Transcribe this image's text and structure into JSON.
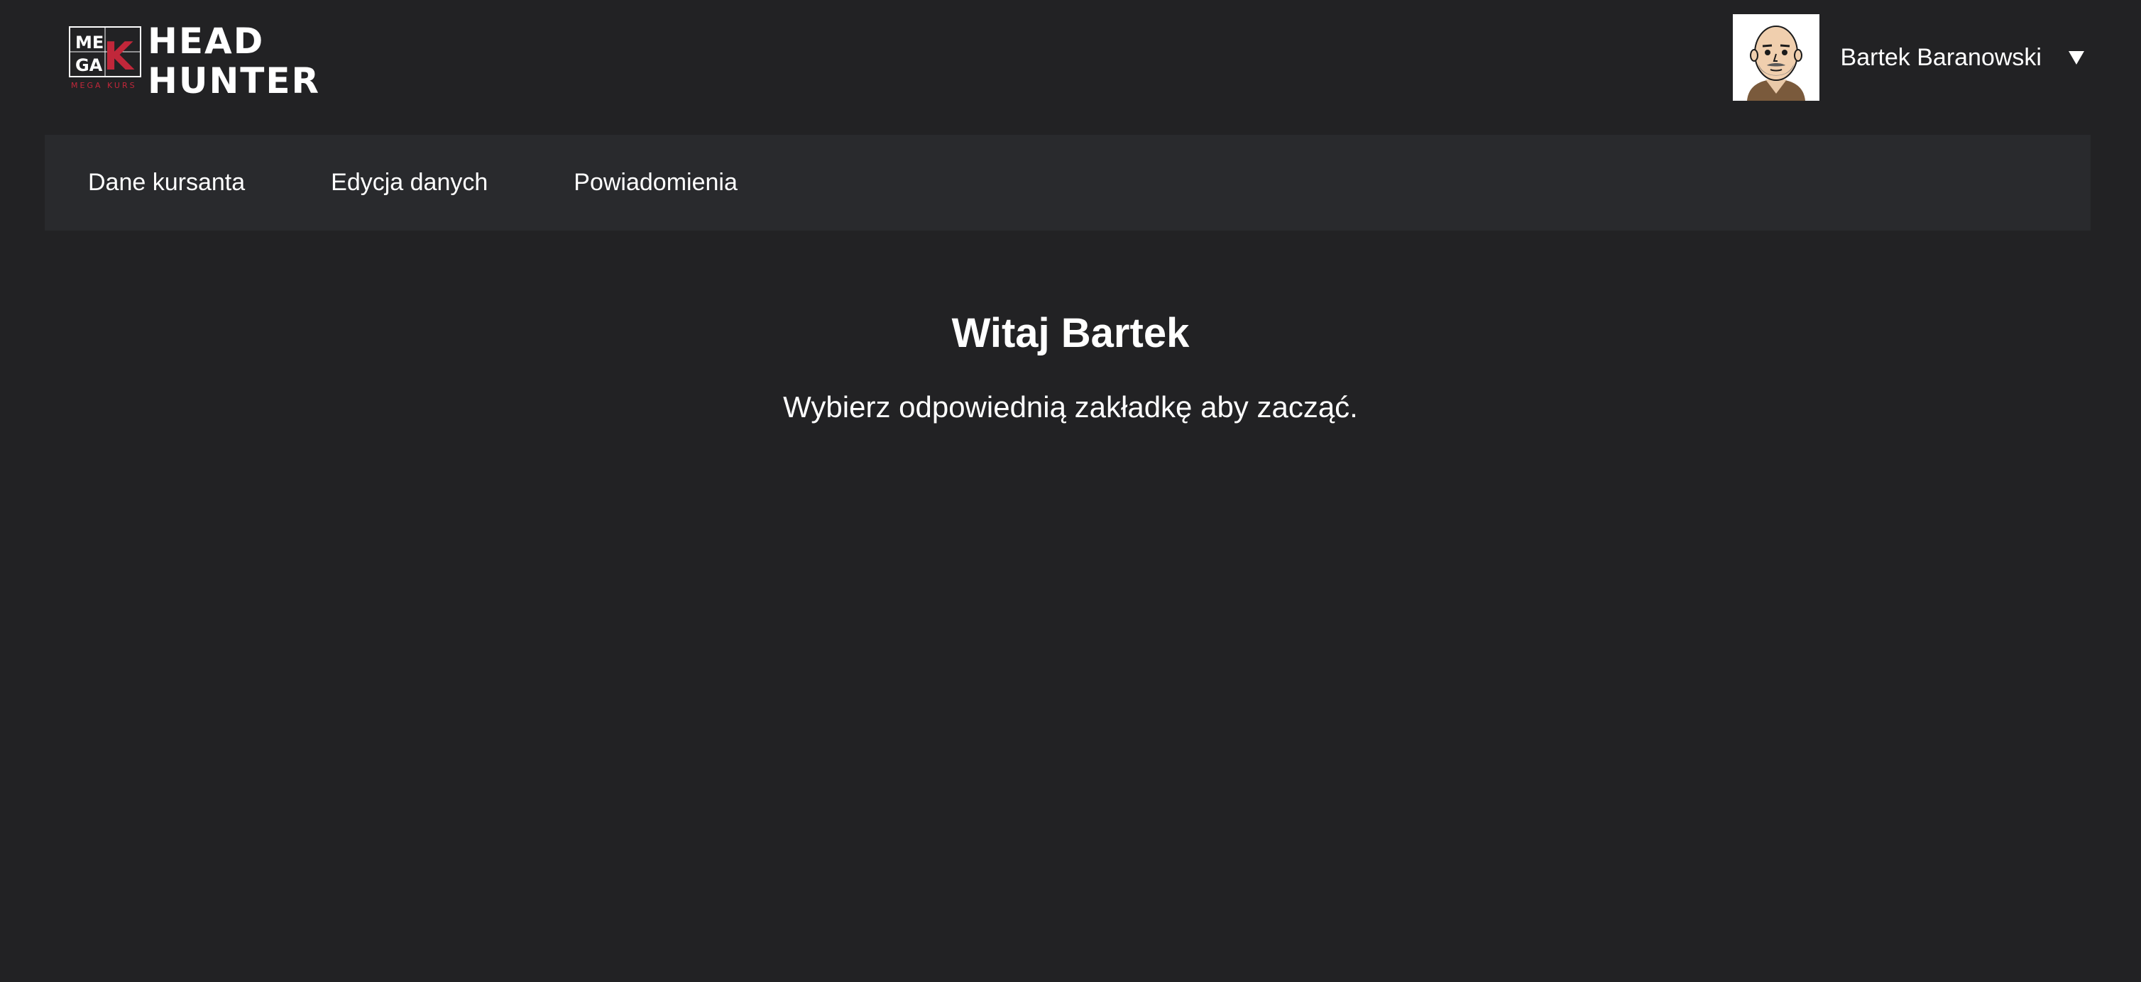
{
  "logo": {
    "mark_top": "ME",
    "mark_bottom": "GA",
    "mark_letter": "K",
    "title_line1": "HEAD",
    "title_line2": "HUNTER",
    "subtitle": "MEGA KURS",
    "accent": "#c1273a"
  },
  "user": {
    "name": "Bartek Baranowski",
    "avatar_icon": "avatar-bald-man",
    "menu_icon": "caret-down-icon"
  },
  "nav": {
    "items": [
      {
        "label": "Dane kursanta"
      },
      {
        "label": "Edycja danych"
      },
      {
        "label": "Powiadomienia"
      }
    ]
  },
  "main": {
    "welcome": "Witaj Bartek",
    "subtitle": "Wybierz odpowiednią zakładkę aby zacząć."
  },
  "colors": {
    "background": "#222224",
    "nav_background": "#292a2d",
    "text": "#ffffff"
  }
}
